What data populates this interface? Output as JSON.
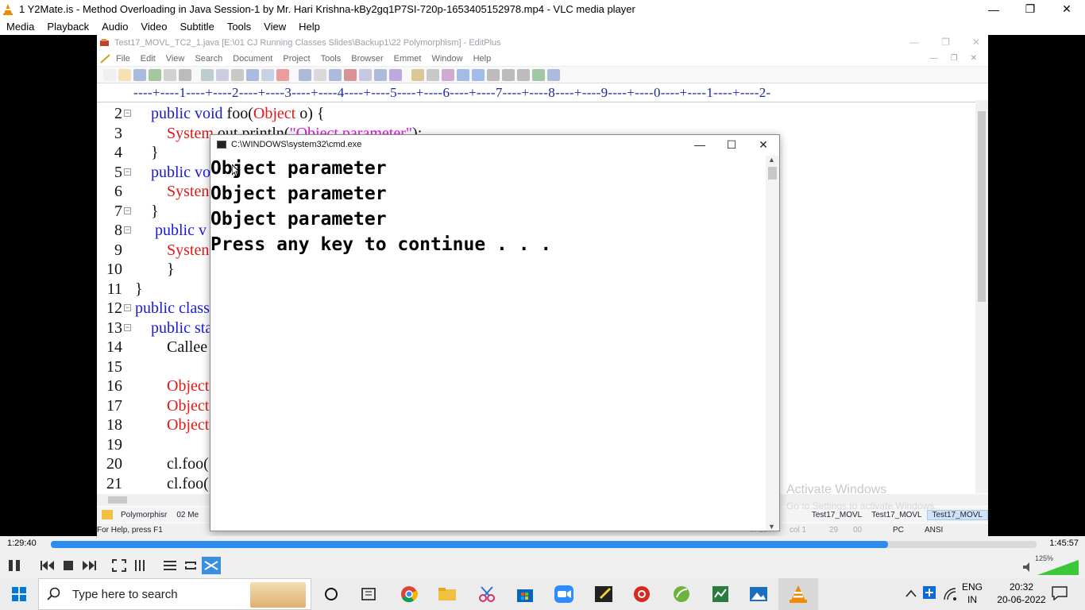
{
  "vlc": {
    "title": "1 Y2Mate.is - Method Overloading in Java  Session-1  by Mr. Hari Krishna-kBy2gq1P7SI-720p-1653405152978.mp4 - VLC media player",
    "menu": [
      "Media",
      "Playback",
      "Audio",
      "Video",
      "Subtitle",
      "Tools",
      "View",
      "Help"
    ],
    "elapsed": "1:29:40",
    "total": "1:45:57",
    "progress": 0.849,
    "volume_label": "125%"
  },
  "editplus": {
    "title": "Test17_MOVL_TC2_1.java [E:\\01 CJ Running Classes Slides\\Backup1\\22 Polymorphism] - EditPlus",
    "menu": [
      "File",
      "Edit",
      "View",
      "Search",
      "Document",
      "Project",
      "Tools",
      "Browser",
      "Emmet",
      "Window",
      "Help"
    ],
    "ruler": "----+----1----+----2----+----3----+----4----+----5----+----6----+----7----+----8----+----9----+----0----+----1----+----2-",
    "lines": [
      {
        "n": "2",
        "fold": "⊟",
        "parts": [
          [
            "kw",
            "    public void "
          ],
          [
            "blk",
            "foo("
          ],
          [
            "rd",
            "Object"
          ],
          [
            "blk",
            " o) {"
          ]
        ]
      },
      {
        "n": "3",
        "fold": "",
        "parts": [
          [
            "rd",
            "        System"
          ],
          [
            "blk",
            ".out.println("
          ],
          [
            "mg",
            "\"Object parameter\""
          ],
          [
            "blk",
            ");"
          ]
        ]
      },
      {
        "n": "4",
        "fold": "",
        "parts": [
          [
            "blk",
            "    }"
          ]
        ]
      },
      {
        "n": "5",
        "fold": "⊟",
        "parts": [
          [
            "kw",
            "    public vo"
          ]
        ]
      },
      {
        "n": "6",
        "fold": "",
        "parts": [
          [
            "rd",
            "        Systen"
          ]
        ]
      },
      {
        "n": "7",
        "fold": "⊟",
        "parts": [
          [
            "blk",
            "    }"
          ]
        ]
      },
      {
        "n": "8",
        "fold": "⊟",
        "parts": [
          [
            "kw",
            "     public v"
          ]
        ]
      },
      {
        "n": "9",
        "fold": "",
        "parts": [
          [
            "rd",
            "        Systen"
          ]
        ]
      },
      {
        "n": "10",
        "fold": "",
        "parts": [
          [
            "blk",
            "        }"
          ]
        ]
      },
      {
        "n": "11",
        "fold": "",
        "parts": [
          [
            "blk",
            "}"
          ]
        ]
      },
      {
        "n": "12",
        "fold": "⊟",
        "parts": [
          [
            "kw",
            "public class"
          ]
        ]
      },
      {
        "n": "13",
        "fold": "⊟",
        "parts": [
          [
            "kw",
            "    public sta"
          ]
        ]
      },
      {
        "n": "14",
        "fold": "",
        "parts": [
          [
            "blk",
            "        Callee"
          ]
        ]
      },
      {
        "n": "15",
        "fold": "",
        "parts": [
          [
            "blk",
            ""
          ]
        ]
      },
      {
        "n": "16",
        "fold": "",
        "parts": [
          [
            "rd",
            "        Object"
          ]
        ]
      },
      {
        "n": "17",
        "fold": "",
        "parts": [
          [
            "rd",
            "        Object"
          ]
        ]
      },
      {
        "n": "18",
        "fold": "",
        "parts": [
          [
            "rd",
            "        Object"
          ]
        ]
      },
      {
        "n": "19",
        "fold": "",
        "parts": [
          [
            "blk",
            ""
          ]
        ]
      },
      {
        "n": "20",
        "fold": "",
        "parts": [
          [
            "blk",
            "        cl.foo("
          ]
        ]
      },
      {
        "n": "21",
        "fold": "",
        "parts": [
          [
            "blk",
            "        cl.foo("
          ]
        ]
      }
    ],
    "tabs_left": [
      "Polymorphisr",
      "02 Me"
    ],
    "tabs_right": [
      "Test17_MOVL",
      "Test17_MOVL",
      "Test17_MOVL"
    ],
    "status": "For Help, press F1",
    "status_right": [
      "In 29",
      "col 1",
      "29",
      "00",
      "PC",
      "ANSI"
    ]
  },
  "activate": {
    "title": "Activate Windows",
    "sub": "Go to Settings to activate Windows."
  },
  "cmd": {
    "title": "C:\\WINDOWS\\system32\\cmd.exe",
    "output": [
      "Object parameter",
      "Object parameter",
      "Object parameter",
      "Press any key to continue . . ."
    ]
  },
  "taskbar": {
    "search_placeholder": "Type here to search",
    "lang": "ENG",
    "region": "IN",
    "time": "20:32",
    "date": "20-06-2022"
  },
  "colors": {
    "keyword": "#1a1adb",
    "type": "#e01818",
    "string": "#d61ad6",
    "seek": "#2d8cf0"
  }
}
